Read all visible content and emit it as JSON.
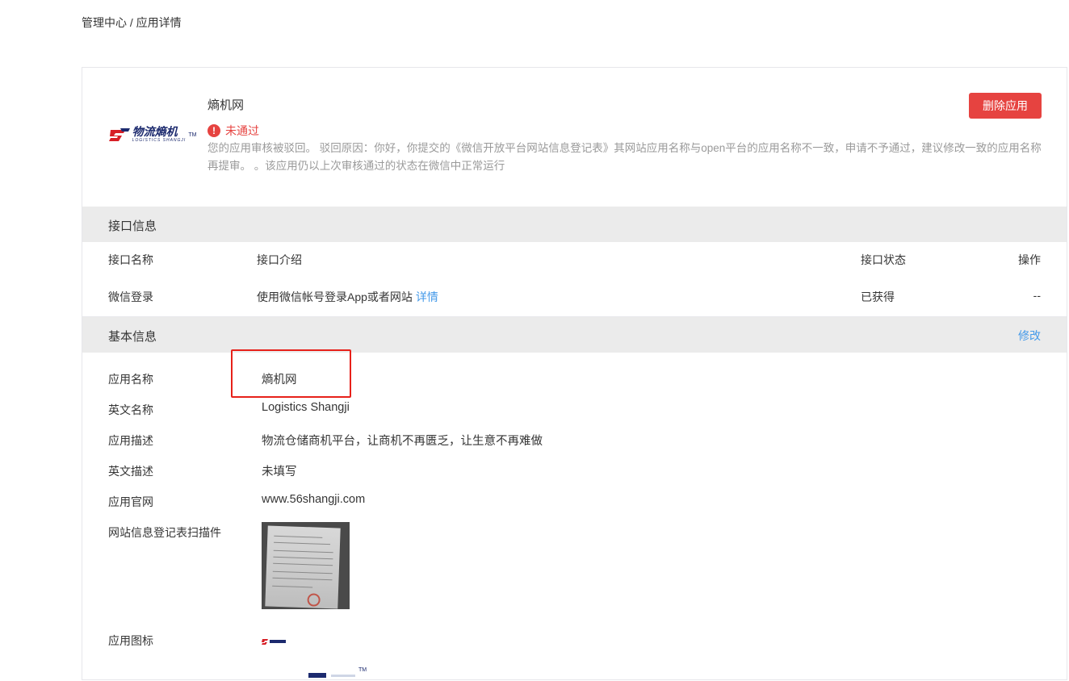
{
  "breadcrumb": "管理中心 / 应用详情",
  "app": {
    "name": "熵机网",
    "status": "未通过",
    "reject_reason": "您的应用审核被驳回。 驳回原因：你好，你提交的《微信开放平台网站信息登记表》其网站应用名称与open平台的应用名称不一致，申请不予通过，建议修改一致的应用名称再提审。 。该应用仍以上次审核通过的状态在微信中正常运行",
    "delete_label": "删除应用",
    "logo": {
      "cn_text": "物流熵机",
      "en_text": "LOGISTICS SHANGJI",
      "tm": "TM"
    }
  },
  "api_section": {
    "title": "接口信息",
    "columns": [
      "接口名称",
      "接口介绍",
      "接口状态",
      "操作"
    ],
    "rows": [
      {
        "name": "微信登录",
        "intro": "使用微信帐号登录App或者网站",
        "detail_link": "详情",
        "status": "已获得",
        "action": "--"
      }
    ]
  },
  "basic_section": {
    "title": "基本信息",
    "edit_label": "修改",
    "fields": [
      {
        "label": "应用名称",
        "value": "熵机网"
      },
      {
        "label": "英文名称",
        "value": "Logistics Shangji"
      },
      {
        "label": "应用描述",
        "value": "物流仓储商机平台，让商机不再匮乏，让生意不再难做"
      },
      {
        "label": "英文描述",
        "value": "未填写"
      },
      {
        "label": "应用官网",
        "value": "www.56shangji.com"
      },
      {
        "label": "网站信息登记表扫描件",
        "value": ""
      },
      {
        "label": "应用图标",
        "value": ""
      }
    ]
  },
  "colors": {
    "danger": "#e64340",
    "link": "#459ae9",
    "section_bg": "#ebebeb",
    "highlight": "#e7211a"
  },
  "icons": {
    "status": "warning-circle-icon"
  }
}
